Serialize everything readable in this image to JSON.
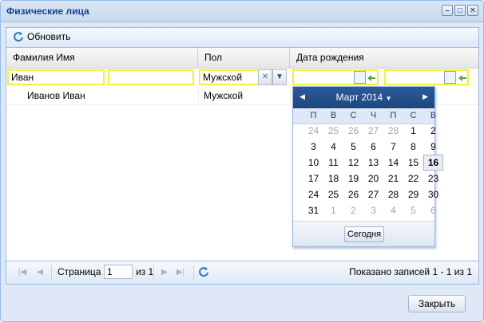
{
  "window": {
    "title": "Физические лица"
  },
  "toolbar": {
    "refresh_label": "Обновить"
  },
  "columns": {
    "name": "Фамилия Имя",
    "gender": "Пол",
    "birthdate": "Дата рождения"
  },
  "filters": {
    "surname_value": "Иван",
    "name_value": "",
    "gender_value": "Мужской",
    "date_from": "",
    "date_to": ""
  },
  "rows": [
    {
      "name": "Иванов Иван",
      "gender": "Мужской",
      "birthdate": ""
    }
  ],
  "calendar": {
    "title": "Март 2014",
    "weekdays": [
      "П",
      "В",
      "С",
      "Ч",
      "П",
      "С",
      "В"
    ],
    "days": [
      [
        "24",
        "25",
        "26",
        "27",
        "28",
        "1",
        "2"
      ],
      [
        "3",
        "4",
        "5",
        "6",
        "7",
        "8",
        "9"
      ],
      [
        "10",
        "11",
        "12",
        "13",
        "14",
        "15",
        "16"
      ],
      [
        "17",
        "18",
        "19",
        "20",
        "21",
        "22",
        "23"
      ],
      [
        "24",
        "25",
        "26",
        "27",
        "28",
        "29",
        "30"
      ],
      [
        "31",
        "1",
        "2",
        "3",
        "4",
        "5",
        "6"
      ]
    ],
    "selected": "16",
    "today_label": "Сегодня"
  },
  "pager": {
    "page_label": "Страница",
    "page_value": "1",
    "of_label": "из 1",
    "summary": "Показано записей 1 - 1 из 1"
  },
  "footer": {
    "close_label": "Закрыть"
  },
  "colors": {
    "accent": "#15428b",
    "highlight": "#f1f13a",
    "header_blue": "#1d477f"
  }
}
